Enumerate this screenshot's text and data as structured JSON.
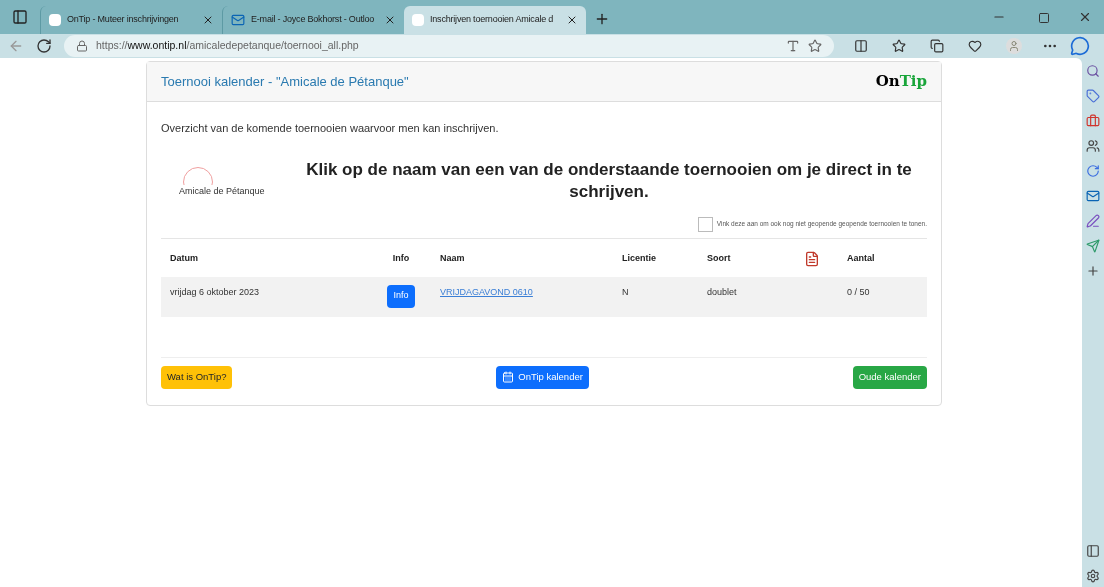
{
  "browser": {
    "tabs": [
      {
        "title": "OnTip - Muteer inschrijvingen",
        "kind": "site",
        "selected": false
      },
      {
        "title": "E-mail - Joyce Bokhorst - Outloo",
        "kind": "mail",
        "selected": false
      },
      {
        "title": "Inschrijven toernooien Amicale d",
        "kind": "site",
        "selected": true
      }
    ],
    "url": "https://**www.ontip.nl**/amicaledepetanque/toernooi_all.php"
  },
  "page": {
    "title": "Toernooi kalender - \"Amicale de Pétanque\"",
    "logo": {
      "part_1": "On",
      "part_2": "Tip"
    },
    "intro": "Overzicht van de komende toernooien waarvoor men kan inschrijven.",
    "club_logo_text": "Amicale de Pétanque",
    "heading": "Klik op de naam van een van de onderstaande toernooien om je direct in te schrijven.",
    "show_unopened": {
      "label": "Vink deze aan om ook nog niet geopende geopende toernooien te tonen.",
      "checked": false
    },
    "table": {
      "columns": [
        "Datum",
        "Info",
        "Naam",
        "Licentie",
        "Soort",
        "Aantal"
      ],
      "rows": [
        {
          "datum": "vrijdag 6 oktober 2023",
          "info": "Info",
          "naam": "VRIJDAGAVOND 0610",
          "licentie": "N",
          "soort": "doublet",
          "aantal": "0 / 50"
        }
      ]
    },
    "buttons": [
      {
        "label": "Wat is OnTip?",
        "kind": "warning"
      },
      {
        "label": "OnTip kalender",
        "kind": "primary"
      },
      {
        "label": "Oude kalender",
        "kind": "success"
      }
    ]
  }
}
